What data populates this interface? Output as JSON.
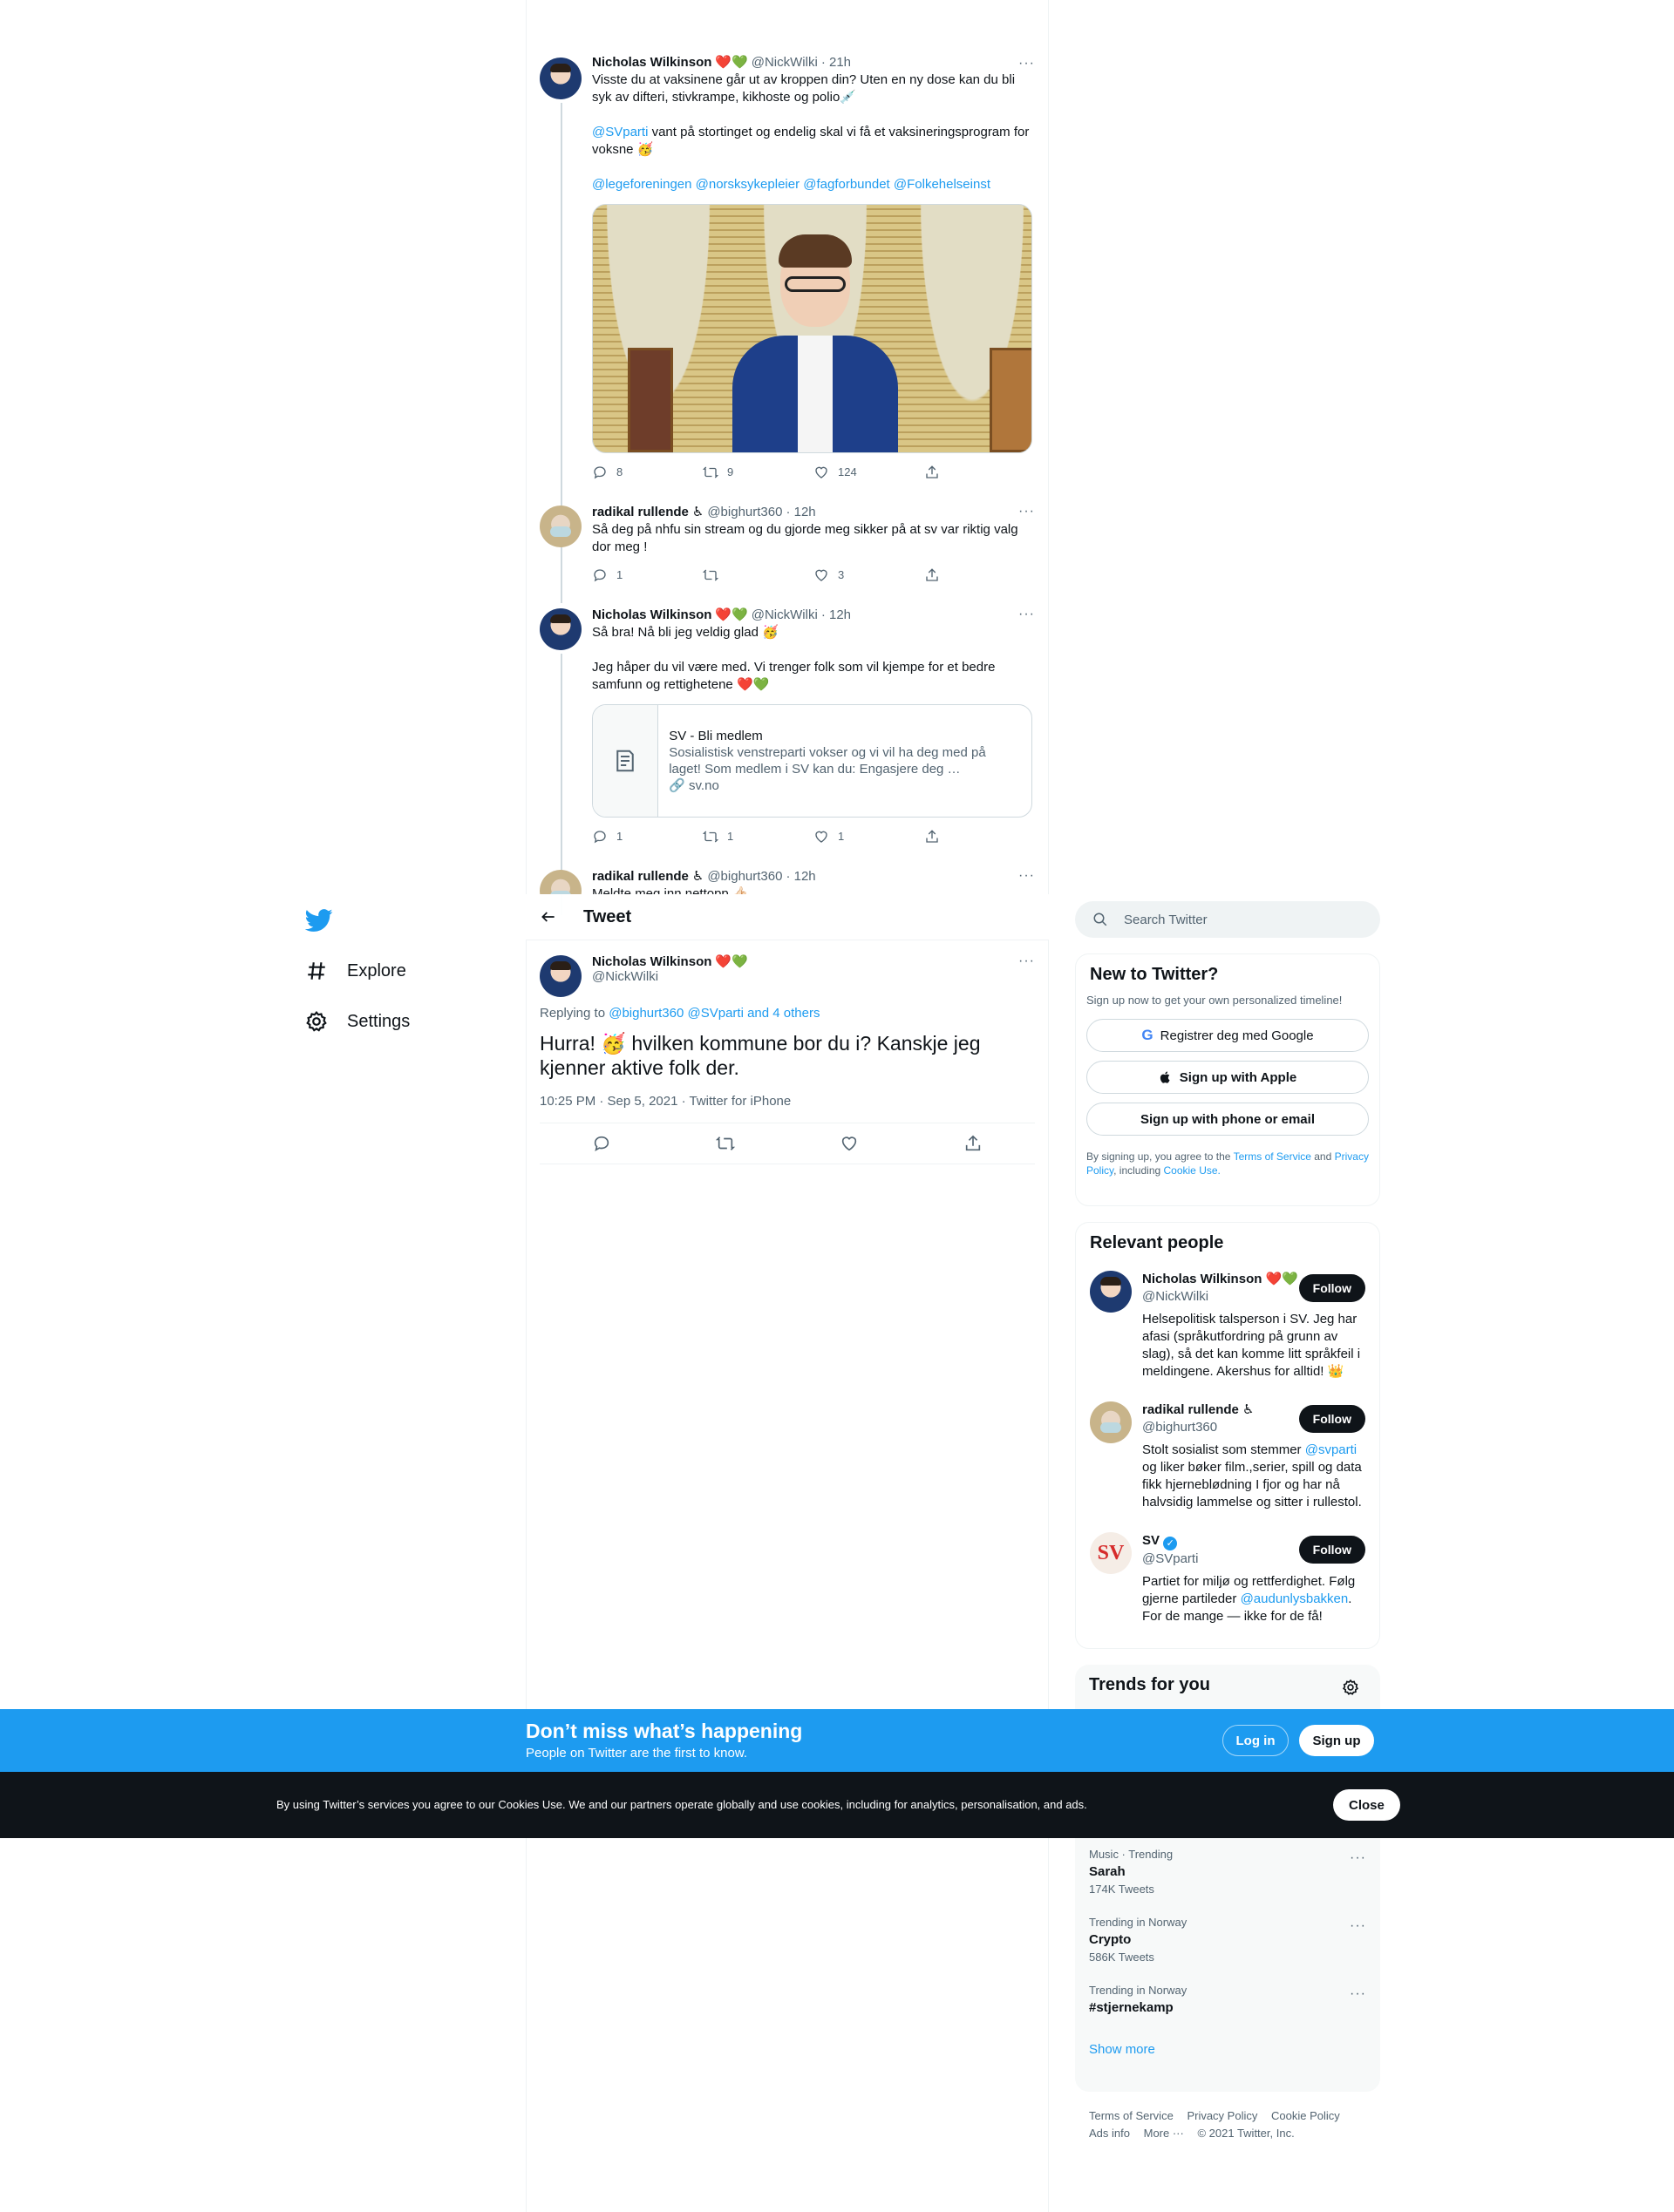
{
  "nav": {
    "logo": "twitter-bird-icon",
    "items": [
      {
        "label": "Explore",
        "icon": "hashtag-icon"
      },
      {
        "label": "Settings",
        "icon": "gear-icon"
      }
    ]
  },
  "thread": [
    {
      "name": "Nicholas Wilkinson",
      "emoji": "❤️💚",
      "handle": "@NickWilki",
      "time": "· 21h",
      "paragraphs": [
        "Visste du at vaksinene går ut av kroppen din? Uten en ny dose kan du bli syk av difteri, stivkrampe, kikhoste og polio💉"
      ],
      "mention_line": {
        "mention": "@SVparti",
        "text": " vant på stortinget og endelig skal vi få et vaksineringsprogram for voksne 🥳"
      },
      "tags": "@legeforeningen @norsksykepleier @fagforbundet @Folkehelseinst",
      "replies": "8",
      "retweets": "9",
      "likes": "124"
    },
    {
      "name": "radikal rullende",
      "emoji": "♿",
      "handle": "@bighurt360",
      "time": "· 12h",
      "text": "Så deg på nhfu sin stream og du gjorde meg sikker på at sv var riktig valg dor meg !",
      "replies": "1",
      "retweets": "",
      "likes": "3"
    },
    {
      "name": "Nicholas Wilkinson",
      "emoji": "❤️💚",
      "handle": "@NickWilki",
      "time": "· 12h",
      "p1": "Så bra! Nå bli jeg veldig glad 🥳",
      "p2": "Jeg håper du vil være med. Vi trenger folk som vil kjempe for et bedre samfunn og rettighetene ❤️💚",
      "card": {
        "title": "SV - Bli medlem",
        "desc": "Sosialistisk venstreparti vokser og vi vil ha deg med på laget! Som medlem i SV kan du: Engasjere deg …",
        "domain": "🔗 sv.no"
      },
      "replies": "1",
      "retweets": "1",
      "likes": "1"
    },
    {
      "name": "radikal rullende",
      "emoji": "♿",
      "handle": "@bighurt360",
      "time": "· 12h",
      "text": "Meldte meg inn nettopp 👍🏻"
    }
  ],
  "header": {
    "title": "Tweet"
  },
  "focus": {
    "name": "Nicholas Wilkinson",
    "emoji": "❤️💚",
    "handle": "@NickWilki",
    "replying_prefix": "Replying to ",
    "replying_to": "@bighurt360 @SVparti and 4 others",
    "text": "Hurra! 🥳 hvilken kommune bor du i? Kanskje jeg kjenner aktive folk der.",
    "meta": "10:25 PM · Sep 5, 2021 · Twitter for iPhone"
  },
  "search": {
    "placeholder": "Search Twitter"
  },
  "new_to_twitter": {
    "title": "New to Twitter?",
    "subtitle": "Sign up now to get your own personalized timeline!",
    "google": "Registrer deg med Google",
    "apple": "Sign up with Apple",
    "phone": "Sign up with phone or email",
    "terms_1": "By signing up, you agree to the ",
    "terms_link1": "Terms of Service",
    "terms_2": " and ",
    "terms_link2": "Privacy Policy",
    "terms_3": ", including ",
    "terms_link3": "Cookie Use."
  },
  "relevant": {
    "title": "Relevant people",
    "follow": "Follow",
    "people": [
      {
        "name": "Nicholas Wilkinson",
        "emoji": "❤️💚",
        "handle": "@NickWilki",
        "bio": "Helsepolitisk talsperson i SV. Jeg har afasi (språkutfordring på grunn av slag), så det kan komme litt språkfeil i meldingene. Akershus for alltid! 👑"
      },
      {
        "name": "radikal rullende",
        "emoji": "♿",
        "handle": "@bighurt360",
        "bio_1": "Stolt sosialist som stemmer ",
        "bio_link": "@svparti",
        "bio_2": " og liker bøker film.,serier, spill og data fikk hjerneblødning I fjor og har nå halvsidig lammelse og sitter i rullestol."
      },
      {
        "name": "SV",
        "handle": "@SVparti",
        "avatar_text": "SV",
        "bio_1": "Partiet for miljø og rettferdighet. Følg gjerne partileder ",
        "bio_link": "@audunlysbakken",
        "bio_2": ". For de mange — ikke for de få!"
      }
    ]
  },
  "trends": {
    "title": "Trends for you",
    "items": [
      {
        "category": "Music · Trending",
        "name": "Sarah",
        "count": "174K Tweets"
      },
      {
        "category": "Trending in Norway",
        "name": "Crypto",
        "count": "586K Tweets"
      },
      {
        "category": "Trending in Norway",
        "name": "#stjernekamp",
        "count": ""
      }
    ],
    "show_more": "Show more"
  },
  "footer": {
    "links": [
      "Terms of Service",
      "Privacy Policy",
      "Cookie Policy",
      "Ads info",
      "More ···",
      "© 2021 Twitter, Inc."
    ]
  },
  "login_bar": {
    "headline": "Don’t miss what’s happening",
    "sub": "People on Twitter are the first to know.",
    "login": "Log in",
    "signup": "Sign up"
  },
  "cookie_bar": {
    "text": "By using Twitter’s services you agree to our Cookies Use. We and our partners operate globally and use cookies, including for analytics, personalisation, and ads.",
    "close": "Close"
  },
  "colors": {
    "accent": "#1d9bf0",
    "text": "#0f1419",
    "muted": "#536471",
    "dark": "#0f1419"
  }
}
